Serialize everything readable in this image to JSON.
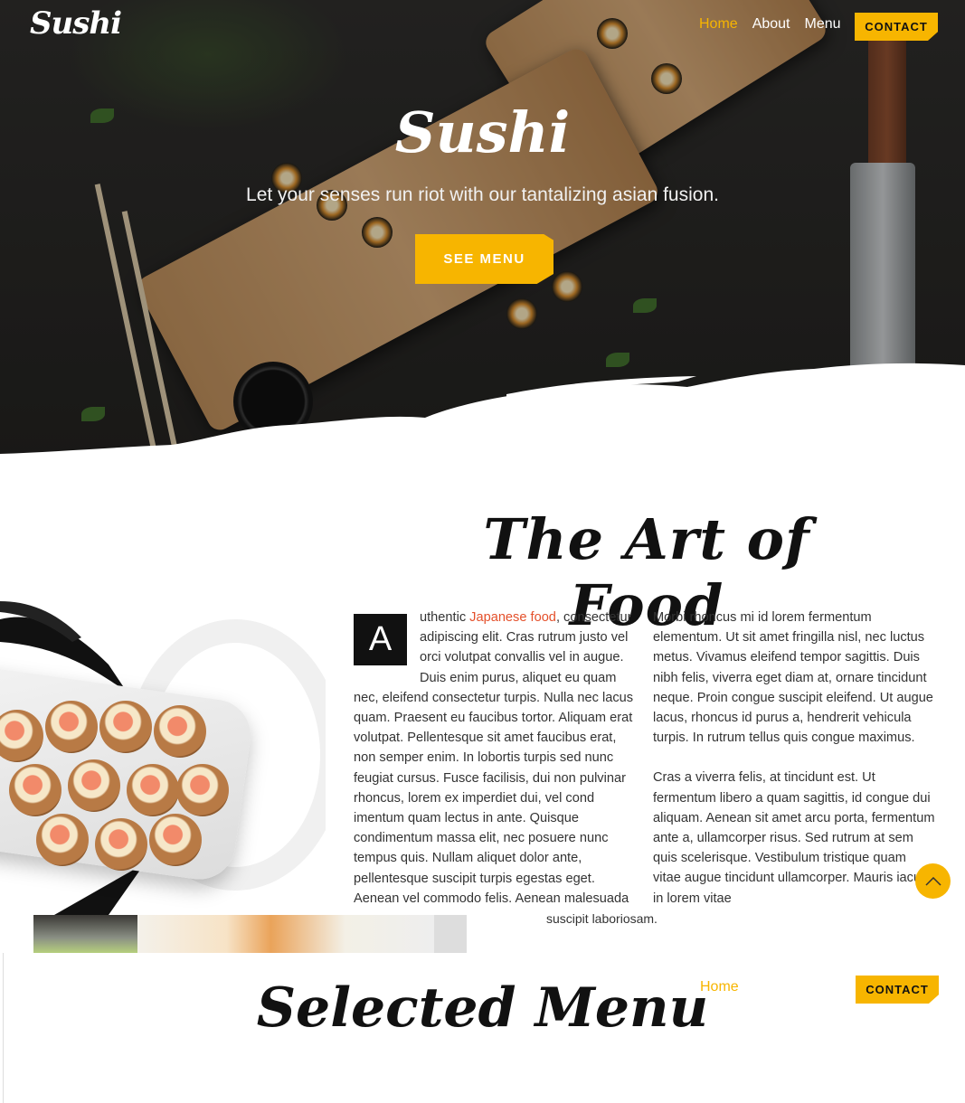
{
  "nav": {
    "logo": "Sushi",
    "links": [
      "Home",
      "About",
      "Menu"
    ],
    "active": "Home",
    "contact_label": "CONTACT"
  },
  "hero": {
    "title": "Sushi",
    "subtitle": "Let your senses run riot with our tantalizing asian fusion.",
    "cta_label": "SEE MENU"
  },
  "art": {
    "title": "The Art of Food",
    "dropcap": "A",
    "col1_lead": "uthentic ",
    "col1_link": "Japanese food",
    "col1_rest": ", consectetur adipiscing elit. Cras rutrum justo vel orci volutpat convallis vel in augue. Duis enim purus, aliquet eu quam nec, eleifend consectetur turpis. Nulla nec lacus quam. Praesent eu faucibus tortor. Aliquam erat volutpat. Pellentesque sit amet faucibus erat, non semper enim. In lobortis turpis sed nunc feugiat cursus. Fusce facilisis, dui non pulvinar rhoncus, lorem ex imperdiet dui, vel cond imentum quam lectus in ante. Quisque condimentum massa elit, nec posuere nunc tempus quis. Nullam aliquet dolor ante, pellentesque suscipit turpis egestas eget. Aenean vel commodo felis. Aenean malesuada",
    "col2_p1": "Morbi rhoncus mi id lorem fermentum elementum. Ut sit amet fringilla nisl, nec luctus metus. Vivamus eleifend tempor sagittis. Duis nibh felis, viverra eget diam at, ornare tincidunt neque. Proin congue suscipit eleifend. Ut augue lacus, rhoncus id purus a, hendrerit vehicula turpis. In rutrum tellus quis congue maximus.",
    "col2_p2": "Cras a viverra felis, at tincidunt est. Ut fermentum libero a quam sagittis, id congue dui aliquam. Aenean sit amet arcu porta, fermentum ante a, ullamcorper risus. Sed rutrum at sem quis scelerisque. Vestibulum tristique quam vitae augue tincidunt ullamcorper. Mauris iaculis in lorem vitae",
    "overflow_text": "suscipit laboriosam."
  },
  "menu_section": {
    "title": "Selected Menu",
    "nav_home": "Home",
    "contact_label": "CONTACT"
  },
  "colors": {
    "accent": "#f7b500",
    "link": "#e4502b",
    "dark": "#111111"
  },
  "icons": {
    "scroll_top": "chevron-up-icon"
  }
}
